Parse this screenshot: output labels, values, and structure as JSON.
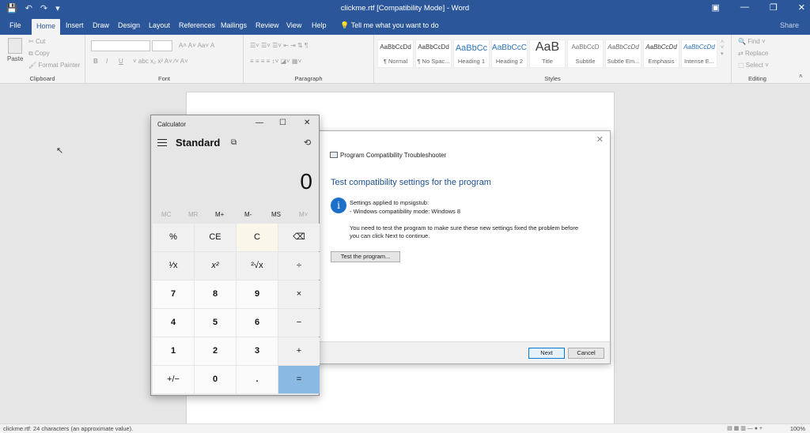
{
  "window": {
    "title": "clickme.rtf [Compatibility Mode] - Word",
    "qat": [
      "💾",
      "↶",
      "↷",
      "▾"
    ],
    "controls": [
      "▣",
      "—",
      "❐",
      "✕"
    ]
  },
  "ribbon_tabs": {
    "items": [
      "File",
      "Home",
      "Insert",
      "Draw",
      "Design",
      "Layout",
      "References",
      "Mailings",
      "Review",
      "View",
      "Help"
    ],
    "tell_me": "Tell me what you want to do",
    "share": "Share"
  },
  "ribbon": {
    "clipboard": {
      "label": "Clipboard",
      "paste": "Paste",
      "cut": "Cut",
      "copy": "Copy",
      "format_painter": "Format Painter"
    },
    "font": {
      "label": "Font",
      "bold": "B",
      "italic": "I",
      "underline": "U"
    },
    "paragraph": {
      "label": "Paragraph"
    },
    "styles": {
      "label": "Styles",
      "items": [
        {
          "sample": "AaBbCcDd",
          "name": "¶ Normal"
        },
        {
          "sample": "AaBbCcDd",
          "name": "¶ No Spac..."
        },
        {
          "sample": "AaBbCc",
          "name": "Heading 1"
        },
        {
          "sample": "AaBbCcC",
          "name": "Heading 2"
        },
        {
          "sample": "AaB",
          "name": "Title"
        },
        {
          "sample": "AaBbCcD",
          "name": "Subtitle"
        },
        {
          "sample": "AaBbCcDd",
          "name": "Subtle Em..."
        },
        {
          "sample": "AaBbCcDd",
          "name": "Emphasis"
        },
        {
          "sample": "AaBbCcDd",
          "name": "Intense E..."
        }
      ]
    },
    "editing": {
      "label": "Editing",
      "find": "Find",
      "replace": "Replace",
      "select": "Select"
    }
  },
  "statusbar": {
    "text": "clickme.rtf: 24 characters (an approximate value).",
    "zoom": "100%"
  },
  "troubleshooter": {
    "window_title": "Program Compatibility Troubleshooter",
    "heading": "Test compatibility settings for the program",
    "applied": "Settings applied to mpsigstub:",
    "mode": "- Windows compatibility mode: Windows 8",
    "instructions_1": "You need to test the program to make sure these new settings fixed the problem before",
    "instructions_2": "you can click Next to continue.",
    "test_button": "Test the program...",
    "next": "Next",
    "cancel": "Cancel"
  },
  "calculator": {
    "title": "Calculator",
    "mode": "Standard",
    "display": "0",
    "memory": [
      "MC",
      "MR",
      "M+",
      "M-",
      "MS",
      "M˅"
    ],
    "keys": [
      [
        "%",
        "CE",
        "C",
        "⌫"
      ],
      [
        "¹⁄x",
        "x²",
        "²√x",
        "÷"
      ],
      [
        "7",
        "8",
        "9",
        "×"
      ],
      [
        "4",
        "5",
        "6",
        "−"
      ],
      [
        "1",
        "2",
        "3",
        "+"
      ],
      [
        "+/−",
        "0",
        ".",
        "="
      ]
    ]
  }
}
